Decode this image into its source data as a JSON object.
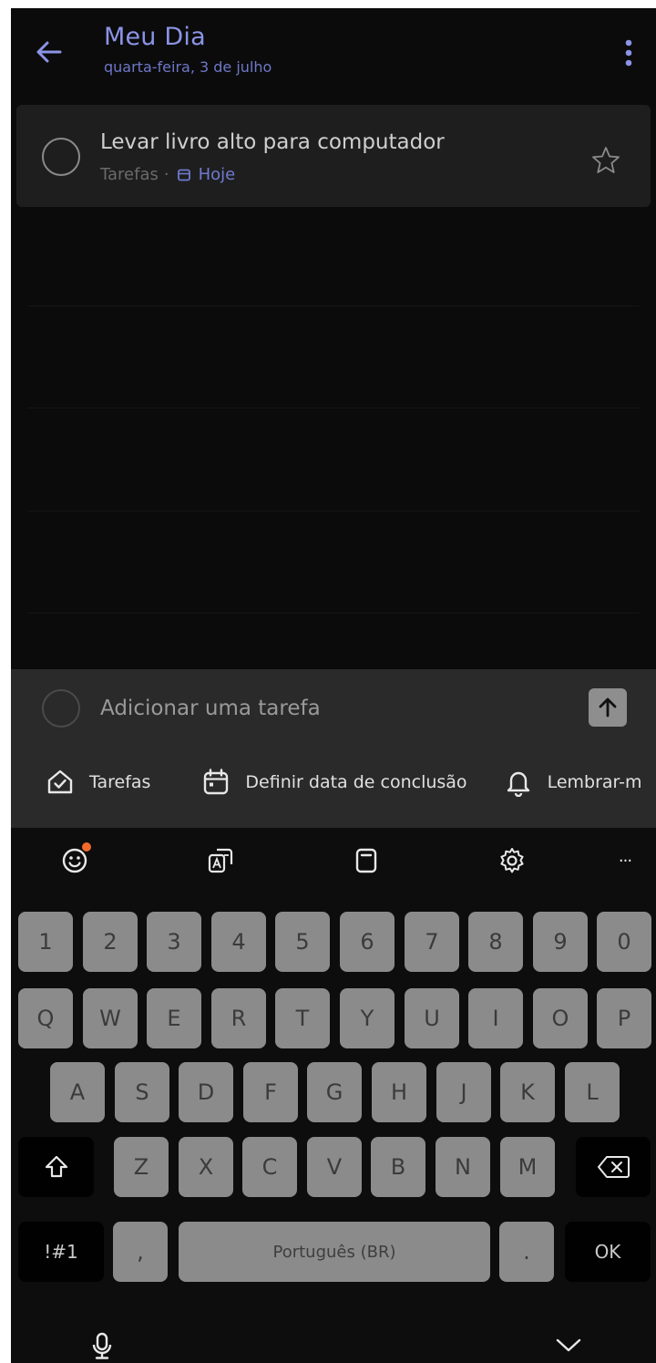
{
  "header": {
    "title": "Meu Dia",
    "subtitle": "quarta-feira, 3 de julho",
    "back_icon": "arrow-left-icon",
    "more_icon": "more-vertical-icon"
  },
  "task": {
    "title": "Levar livro alto para computador",
    "list_name": "Tarefas",
    "separator": "·",
    "due_label": "Hoje",
    "star_icon": "star-outline-icon"
  },
  "add_task": {
    "placeholder": "Adicionar uma tarefa",
    "send_icon": "arrow-up-icon",
    "chips": [
      {
        "label": "Tarefas",
        "icon": "house-check-icon"
      },
      {
        "label": "Definir data de conclusão",
        "icon": "calendar-icon"
      },
      {
        "label": "Lembrar-m",
        "icon": "bell-icon"
      }
    ]
  },
  "keyboard": {
    "toolbar_icons": [
      "emoji-icon",
      "translate-icon",
      "clipboard-icon",
      "gear-icon",
      "more-horizontal-icon"
    ],
    "more_label": "···",
    "row_numbers": [
      "1",
      "2",
      "3",
      "4",
      "5",
      "6",
      "7",
      "8",
      "9",
      "0"
    ],
    "row_q": [
      "Q",
      "W",
      "E",
      "R",
      "T",
      "Y",
      "U",
      "I",
      "O",
      "P"
    ],
    "row_a": [
      "A",
      "S",
      "D",
      "F",
      "G",
      "H",
      "J",
      "K",
      "L"
    ],
    "row_z": [
      "Z",
      "X",
      "C",
      "V",
      "B",
      "N",
      "M"
    ],
    "symbols_label": "!#1",
    "comma_label": ",",
    "space_label": "Português (BR)",
    "period_label": ".",
    "ok_label": "OK"
  },
  "colors": {
    "accent": "#8b94e6",
    "background": "#0b0b0b",
    "card": "#1e1e1e",
    "key": "#8b8b8b"
  }
}
